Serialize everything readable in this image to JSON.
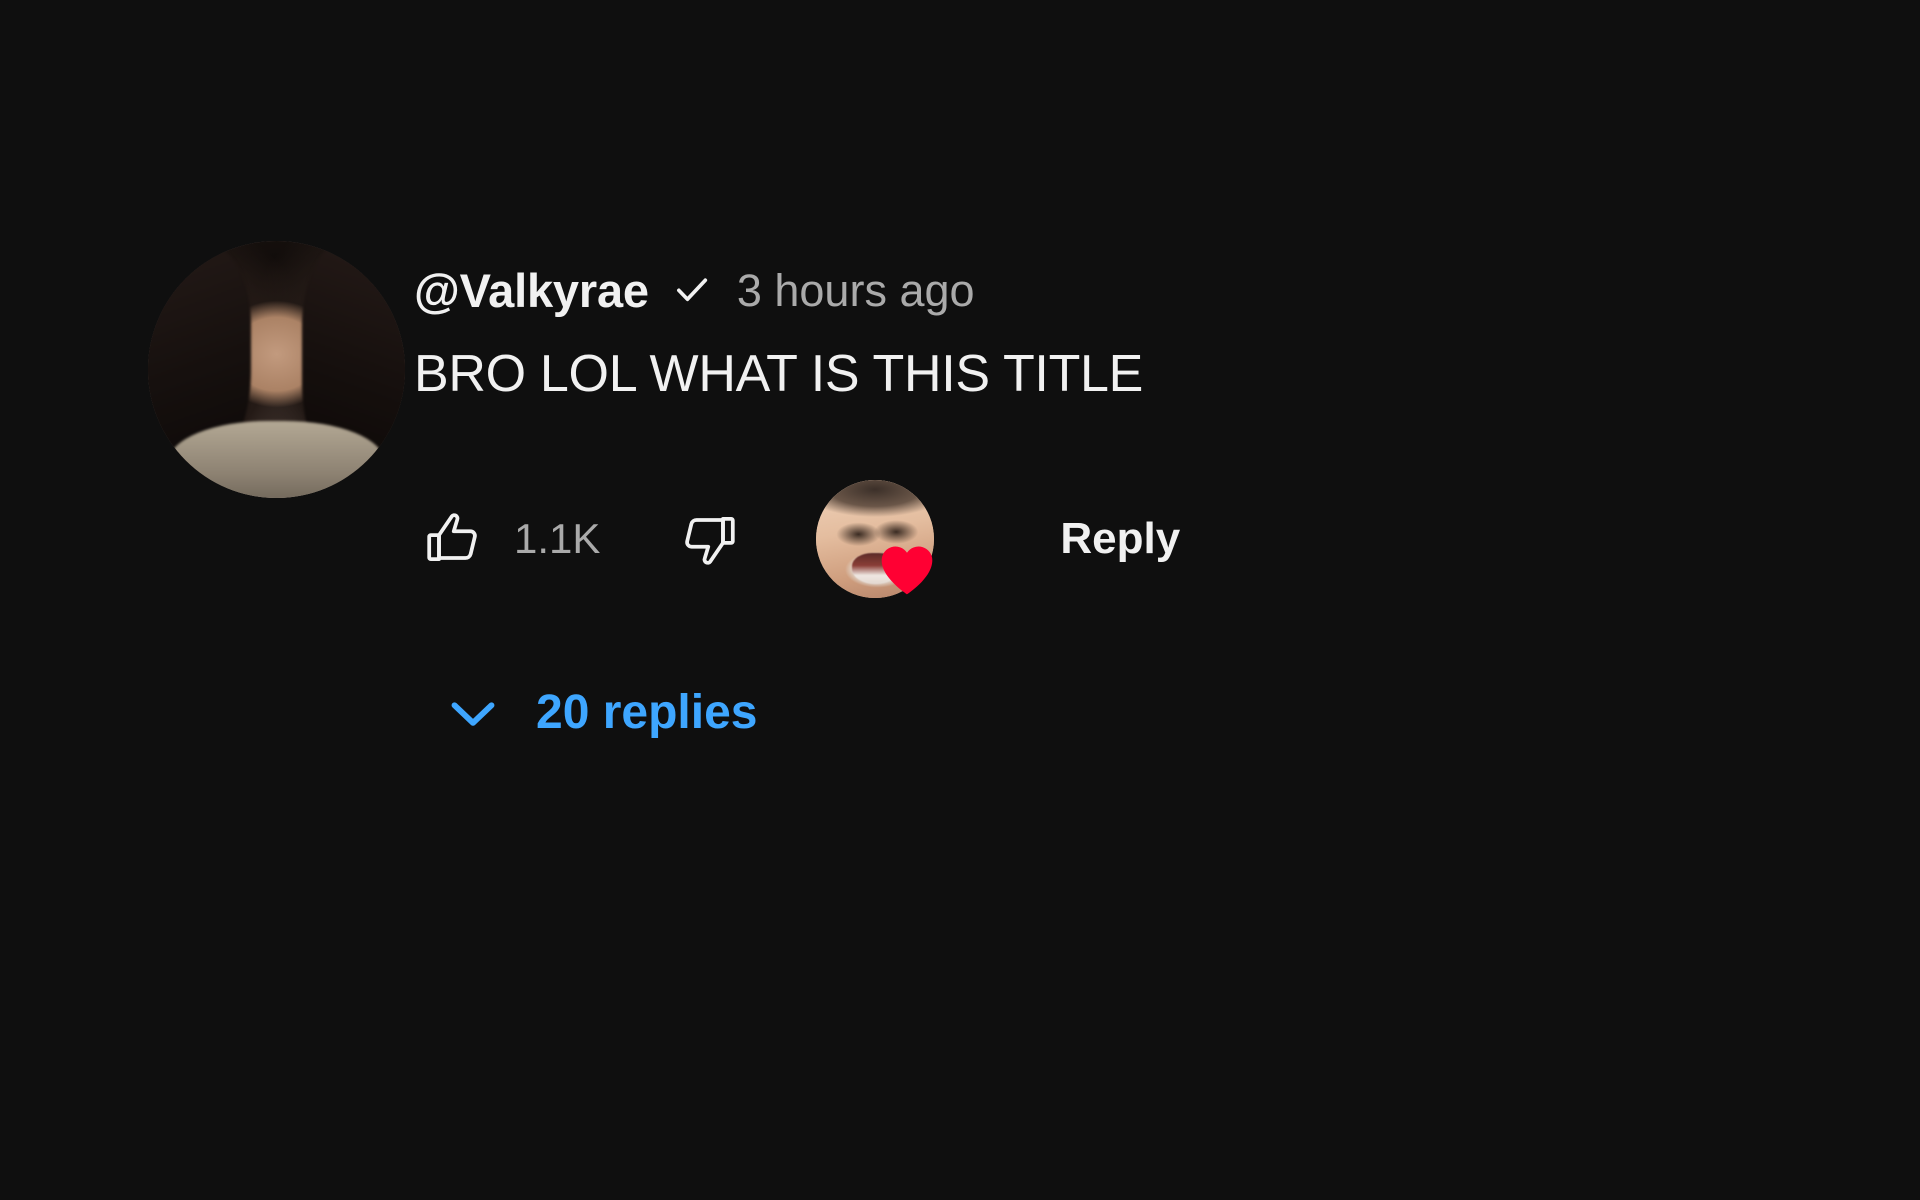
{
  "theme": {
    "background": "#0f0f0f",
    "primary_text": "#f1f1f1",
    "secondary_text": "#aaaaaa",
    "link_blue": "#3ea6ff",
    "heart_red": "#ff0033"
  },
  "comment": {
    "avatar": {
      "icon": "user-avatar-photo",
      "alt": "Valkyrae profile photo"
    },
    "author_handle": "@Valkyrae",
    "verified_icon": "verified-check-icon",
    "timestamp": "3 hours ago",
    "text": "BRO LOL WHAT IS THIS TITLE",
    "actions": {
      "like": {
        "icon": "thumbs-up-icon",
        "count": "1.1K"
      },
      "dislike": {
        "icon": "thumbs-down-icon",
        "count": ""
      },
      "creator_heart": {
        "icon": "heart-icon",
        "avatar_icon": "creator-avatar-photo",
        "alt": "Hearted by creator"
      },
      "reply_label": "Reply"
    },
    "replies": {
      "toggle_icon": "chevron-down-icon",
      "label": "20 replies",
      "count": 20
    }
  }
}
